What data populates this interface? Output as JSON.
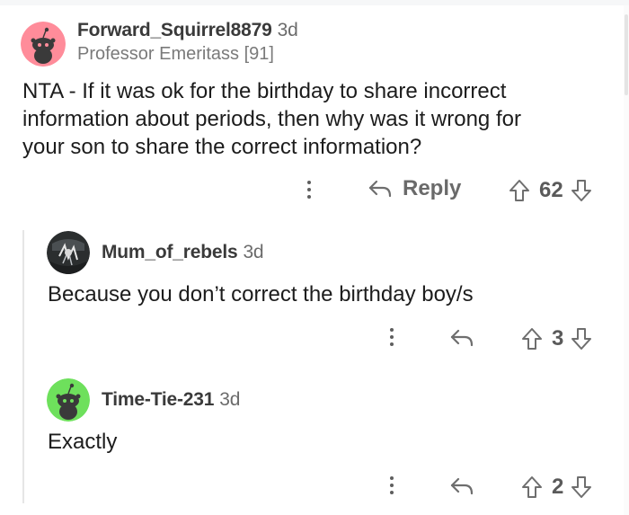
{
  "comments": [
    {
      "username": "Forward_Squirrel8879",
      "time": "3d",
      "flair": "Professor Emeritass [91]",
      "body": [
        "NTA - If it was ok for the birthday to share incorrect",
        "information about periods, then why was it wrong for",
        "your son to share the correct information?"
      ],
      "reply_label": "Reply",
      "votes": "62",
      "avatar_color": "#ff8c9a"
    },
    {
      "username": "Mum_of_rebels",
      "time": "3d",
      "body": [
        "Because you don’t correct the birthday boy/s"
      ],
      "votes": "3"
    },
    {
      "username": "Time-Tie-231",
      "time": "3d",
      "body": [
        "Exactly"
      ],
      "votes": "2",
      "avatar_color": "#6ee05c"
    }
  ],
  "icons": {
    "more": "more-options-icon",
    "reply": "reply-arrow-icon",
    "upvote": "upvote-arrow-icon",
    "downvote": "downvote-arrow-icon"
  }
}
